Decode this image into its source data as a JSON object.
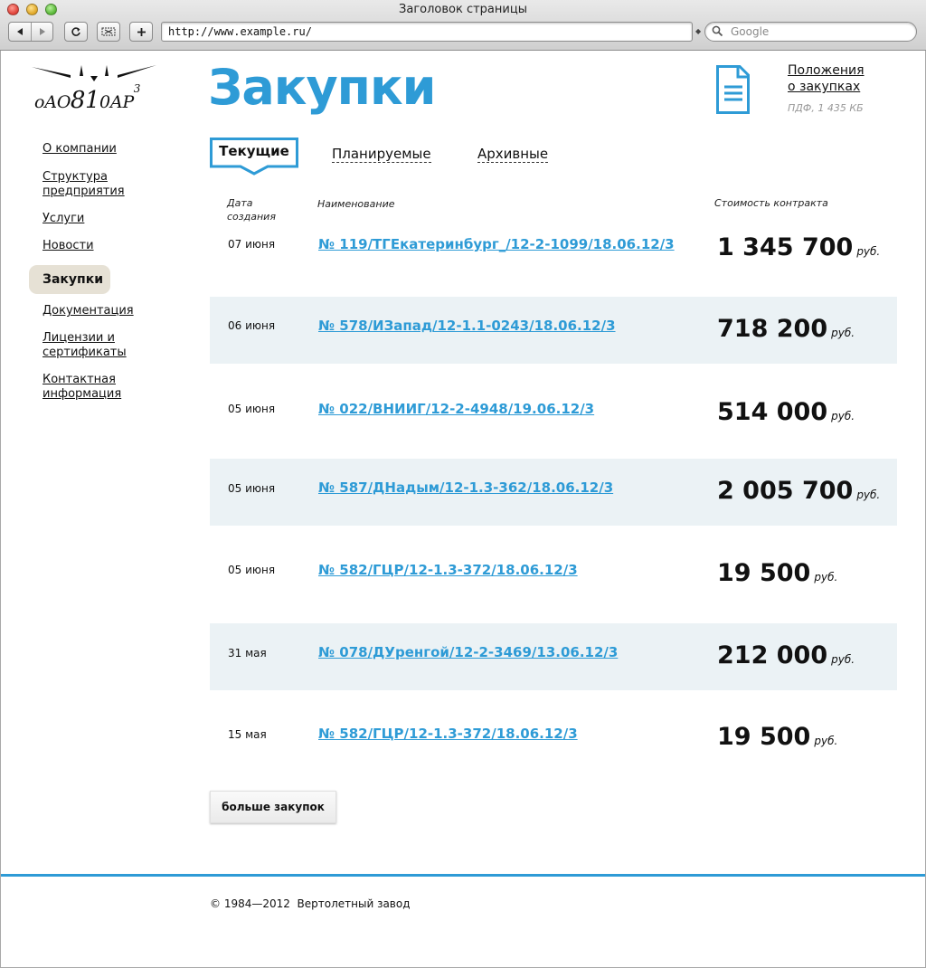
{
  "browser": {
    "window_title": "Заголовок страницы",
    "url": "http://www.example.ru/",
    "search_placeholder": "Google"
  },
  "logo": {
    "text_prefix": "оАО",
    "text_big": "8",
    "text_mid": "1",
    "text_suffix": "0АР",
    "sup": "3"
  },
  "sidebar": {
    "items": [
      {
        "label": "О компании"
      },
      {
        "label": "Структура предприятия"
      },
      {
        "label": "Услуги"
      },
      {
        "label": "Новости"
      },
      {
        "label": "Закупки",
        "active": true
      },
      {
        "label": "Документация"
      },
      {
        "label": "Лицензии и сертификаты"
      },
      {
        "label": "Контактная информация"
      }
    ]
  },
  "page": {
    "title": "Закупки",
    "doc_link_line1": "Положения",
    "doc_link_line2": "о закупках",
    "doc_meta": "ПДФ, 1 435 КБ"
  },
  "tabs": [
    {
      "label": "Текущие",
      "active": true
    },
    {
      "label": "Планируемые"
    },
    {
      "label": "Архивные"
    }
  ],
  "table": {
    "headers": {
      "date": "Дата создания",
      "name": "Наименование",
      "price": "Стоимость контракта"
    },
    "currency": "руб.",
    "rows": [
      {
        "date": "07 июня",
        "name": "№ 119/ТГЕкатеринбург_/12-2-1099/18.06.12/3",
        "price": "1 345 700"
      },
      {
        "date": "06 июня",
        "name": "№ 578/ИЗапад/12-1.1-0243/18.06.12/3",
        "price": "718 200"
      },
      {
        "date": "05 июня",
        "name": "№ 022/ВНИИГ/12-2-4948/19.06.12/3",
        "price": "514 000"
      },
      {
        "date": "05 июня",
        "name": "№ 587/ДНадым/12-1.3-362/18.06.12/3",
        "price": "2 005 700"
      },
      {
        "date": "05 июня",
        "name": "№ 582/ГЦР/12-1.3-372/18.06.12/3",
        "price": "19 500"
      },
      {
        "date": "31 мая",
        "name": "№ 078/ДУренгой/12-2-3469/13.06.12/3",
        "price": "212 000"
      },
      {
        "date": "15 мая",
        "name": "№ 582/ГЦР/12-1.3-372/18.06.12/3",
        "price": "19 500"
      }
    ]
  },
  "more_button": "больше закупок",
  "footer": {
    "copyright": "© 1984—2012  Вертолетный завод"
  },
  "colors": {
    "accent": "#2e9bd6",
    "row_shade": "#ebf2f5",
    "active_nav_bg": "#e6e1d5"
  }
}
